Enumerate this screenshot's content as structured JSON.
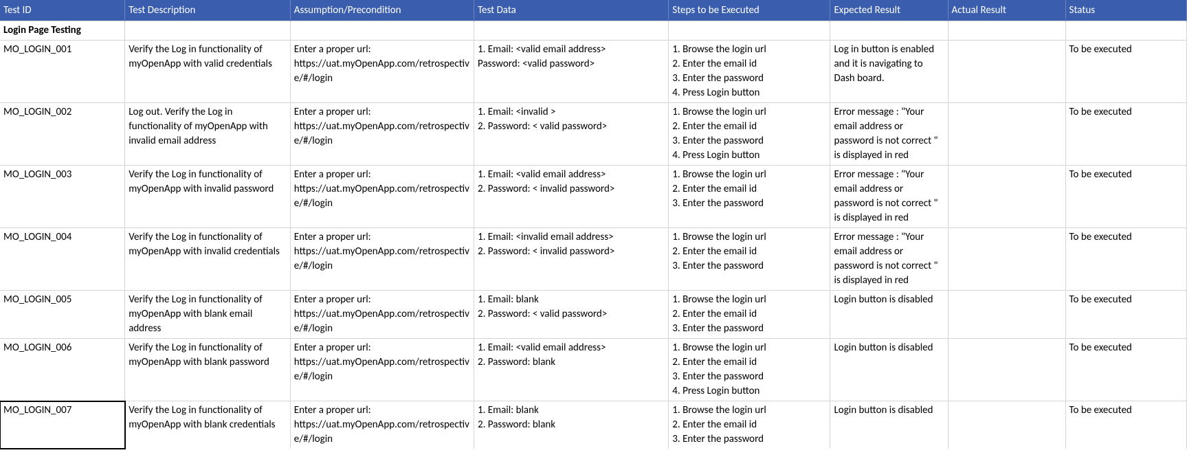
{
  "headers": [
    "Test ID",
    "Test Description",
    "Assumption/Precondition",
    "Test Data",
    "Steps to be Executed",
    "Expected Result",
    "Actual Result",
    "Status"
  ],
  "section": "Login Page Testing",
  "rows": [
    {
      "id": "MO_LOGIN_001",
      "desc": "Verify the Log in functionality of myOpenApp with valid credentials",
      "assump": "Enter a proper url:\nhttps://uat.myOpenApp.com/retrospective/#/login",
      "testdata": "1. Email: <valid email address>\n    Password: <valid password>",
      "steps": "1. Browse the login url\n2. Enter the email id\n3. Enter the password\n4. Press Login button",
      "expect": "Log in button is enabled and it is navigating to Dash board.",
      "actual": "",
      "status": "To be executed"
    },
    {
      "id": "MO_LOGIN_002",
      "desc": "Log out. Verify the Log in functionality of myOpenApp with invalid email address",
      "assump": "Enter a proper url:\nhttps://uat.myOpenApp.com/retrospective/#/login",
      "testdata": "1. Email: <invalid >\n2.  Password: < valid password>",
      "steps": "1. Browse the login url\n2. Enter the email id\n3. Enter the password\n4. Press Login button",
      "expect": "Error message : \"Your email address or password is not correct \" is displayed in red",
      "actual": "",
      "status": "To be executed"
    },
    {
      "id": "MO_LOGIN_003",
      "desc": "Verify the Log in functionality of myOpenApp with invalid password",
      "assump": "Enter a proper url:\nhttps://uat.myOpenApp.com/retrospective/#/login",
      "testdata": "1. Email: <valid email address>\n2. Password: < invalid password>",
      "steps": "1. Browse the login url\n2. Enter the email id\n3. Enter the password",
      "expect": "Error message : \"Your email address or password is not correct \" is displayed in red",
      "actual": "",
      "status": "To be executed"
    },
    {
      "id": "MO_LOGIN_004",
      "desc": "Verify the Log in functionality of myOpenApp with invalid credentials",
      "assump": "Enter a proper url:\nhttps://uat.myOpenApp.com/retrospective/#/login",
      "testdata": "1. Email: <invalid email address>\n2. Password: < invalid password>",
      "steps": "1. Browse the login url\n2. Enter the email id\n3. Enter the password",
      "expect": "Error message : \"Your email address or password is not correct \" is displayed in red",
      "actual": "",
      "status": "To be executed"
    },
    {
      "id": "MO_LOGIN_005",
      "desc": "Verify the Log in functionality of myOpenApp with blank email address",
      "assump": "Enter a proper url:\nhttps://uat.myOpenApp.com/retrospective/#/login",
      "testdata": "1. Email: blank\n2. Password: < valid password>",
      "steps": "1. Browse the login url\n2. Enter the email id\n3. Enter the password",
      "expect": "Login button is disabled",
      "actual": "",
      "status": "To be executed"
    },
    {
      "id": "MO_LOGIN_006",
      "desc": "Verify the Log in functionality of myOpenApp with blank password",
      "assump": "Enter a proper url:\nhttps://uat.myOpenApp.com/retrospective/#/login",
      "testdata": "1. Email: <valid email address>\n2.  Password: blank",
      "steps": "1. Browse the login url\n2. Enter the email id\n3. Enter the password\n4. Press Login button",
      "expect": "Login button is disabled",
      "actual": "",
      "status": "To be executed"
    },
    {
      "id": "MO_LOGIN_007",
      "desc": "Verify the Log in functionality of myOpenApp with blank credentials",
      "assump": "Enter a proper url:\nhttps://uat.myOpenApp.com/retrospective/#/login",
      "testdata": "1. Email: blank\n2. Password: blank",
      "steps": "1. Browse the login url\n2. Enter the email id\n3. Enter the password",
      "expect": "Login button is disabled",
      "actual": "",
      "status": "To be executed"
    }
  ],
  "selected_row_index": 6
}
